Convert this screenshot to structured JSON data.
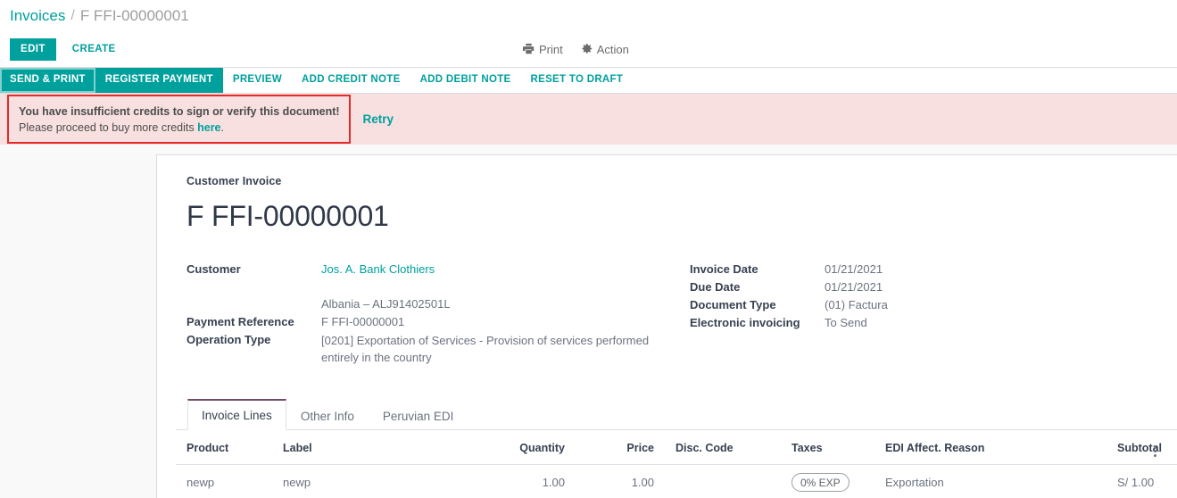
{
  "breadcrumb": {
    "root": "Invoices",
    "separator": "/",
    "current": "F FFI-00000001"
  },
  "control_panel": {
    "edit_label": "EDIT",
    "create_label": "CREATE",
    "print_label": "Print",
    "print_icon": "printer-icon",
    "action_label": "Action",
    "action_icon": "gear-icon"
  },
  "statusbar_buttons": [
    {
      "label": "SEND & PRINT",
      "style": "filled",
      "focused": true
    },
    {
      "label": "REGISTER PAYMENT",
      "style": "filled",
      "focused": false
    },
    {
      "label": "PREVIEW",
      "style": "link",
      "focused": false
    },
    {
      "label": "ADD CREDIT NOTE",
      "style": "link",
      "focused": false
    },
    {
      "label": "ADD DEBIT NOTE",
      "style": "link",
      "focused": false
    },
    {
      "label": "RESET TO DRAFT",
      "style": "link",
      "focused": false
    }
  ],
  "alert": {
    "title": "You have insufficient credits to sign or verify this document!",
    "body_prefix": "Please proceed to buy more credits ",
    "body_link": "here",
    "body_suffix": ".",
    "retry_label": "Retry",
    "border_color": "#e52a2a",
    "background_color": "#f8e0e0"
  },
  "document": {
    "kind": "Customer Invoice",
    "title": "F FFI-00000001",
    "left_fields": [
      {
        "label": "Customer",
        "value": "Jos. A. Bank Clothiers",
        "is_link": true
      },
      {
        "label": "",
        "value": "Albania – ALJ91402501L",
        "is_link": false
      },
      {
        "label": "Payment Reference",
        "value": "F FFI-00000001",
        "is_link": false
      },
      {
        "label": "Operation Type",
        "value": "[0201] Exportation of Services - Provision of services performed entirely in the country",
        "is_link": false
      }
    ],
    "right_fields": [
      {
        "label": "Invoice Date",
        "value": "01/21/2021"
      },
      {
        "label": "Due Date",
        "value": "01/21/2021"
      },
      {
        "label": "Document Type",
        "value": "(01) Factura"
      },
      {
        "label": "Electronic invoicing",
        "value": "To Send"
      }
    ]
  },
  "notebook": {
    "tabs": [
      {
        "label": "Invoice Lines",
        "active": true
      },
      {
        "label": "Other Info",
        "active": false
      },
      {
        "label": "Peruvian EDI",
        "active": false
      }
    ]
  },
  "lines_table": {
    "columns": [
      {
        "label": "Product",
        "align": "left"
      },
      {
        "label": "Label",
        "align": "left"
      },
      {
        "label": "Quantity",
        "align": "right"
      },
      {
        "label": "Price",
        "align": "right"
      },
      {
        "label": "Disc. Code",
        "align": "left"
      },
      {
        "label": "Taxes",
        "align": "left"
      },
      {
        "label": "EDI Affect. Reason",
        "align": "left"
      },
      {
        "label": "Subtotal",
        "align": "right"
      }
    ],
    "optional_columns_icon": "vertical-dots-icon",
    "rows": [
      {
        "product": "newp",
        "label": "newp",
        "quantity": "1.00",
        "price": "1.00",
        "disc_code": "",
        "taxes": "0% EXP",
        "edi_affect_reason": "Exportation",
        "subtotal": "S/ 1.00"
      }
    ]
  },
  "theme": {
    "primary": "#00A09D",
    "accent_tab": "#714b67",
    "text": "#4c4c4c",
    "muted": "#6b7280"
  }
}
